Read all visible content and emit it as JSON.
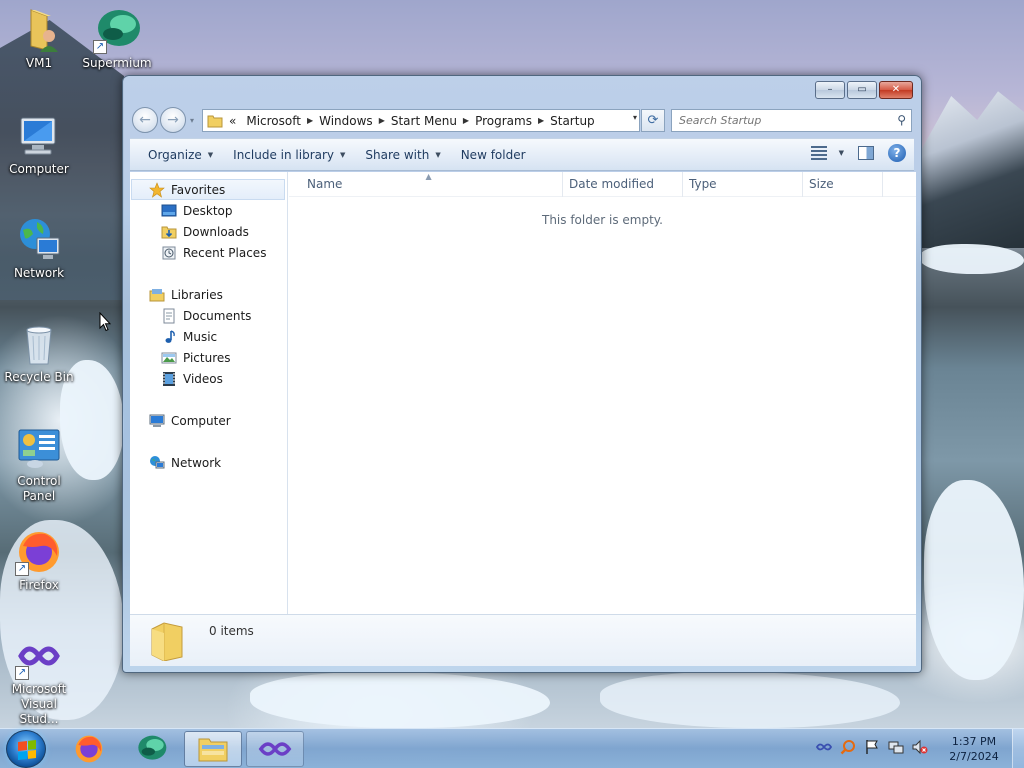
{
  "desktop": {
    "icons": [
      {
        "label": "VM1"
      },
      {
        "label": "Supermium"
      },
      {
        "label": "Computer"
      },
      {
        "label": "Network"
      },
      {
        "label": "Recycle Bin"
      },
      {
        "label": "Control Panel"
      },
      {
        "label": "Firefox"
      },
      {
        "label": "Microsoft Visual Stud..."
      }
    ]
  },
  "window": {
    "caption": {
      "minimize": "–",
      "maximize": "▭",
      "close": "✕"
    },
    "nav": {
      "back": "←",
      "forward": "→",
      "history_dropdown": "▾"
    },
    "address": {
      "overflow": "«",
      "crumbs": [
        "Microsoft",
        "Windows",
        "Start Menu",
        "Programs",
        "Startup"
      ],
      "separator": "▶",
      "dropdown": "▾",
      "refresh": "⟳"
    },
    "search": {
      "placeholder": "Search Startup",
      "icon": "⚲"
    },
    "toolbar": {
      "organize": "Organize",
      "include_in_library": "Include in library",
      "share_with": "Share with",
      "new_folder": "New folder",
      "caret": "▼",
      "help": "?"
    },
    "nav_pane": {
      "favorites": "Favorites",
      "favorites_items": [
        "Desktop",
        "Downloads",
        "Recent Places"
      ],
      "libraries": "Libraries",
      "libraries_items": [
        "Documents",
        "Music",
        "Pictures",
        "Videos"
      ],
      "computer": "Computer",
      "network": "Network"
    },
    "columns": {
      "name": "Name",
      "date_modified": "Date modified",
      "type": "Type",
      "size": "Size",
      "sort_indicator": "▲"
    },
    "empty_message": "This folder is empty.",
    "details": {
      "item_count": "0 items"
    }
  },
  "taskbar": {
    "clock_time": "1:37 PM",
    "clock_date": "2/7/2024"
  },
  "colors": {
    "accent": "#1c5cb0",
    "window_frame": "#a8c4e4",
    "close_button": "#c23a22",
    "folder_yellow": "#f1cf62"
  }
}
